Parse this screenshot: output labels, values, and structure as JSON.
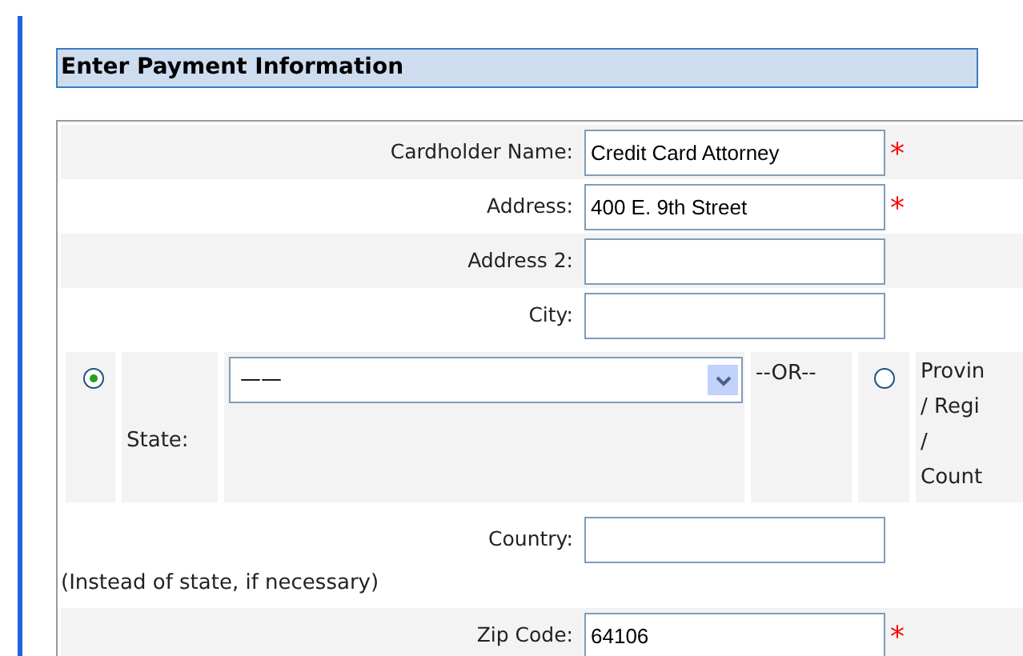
{
  "heading": "Enter Payment Information",
  "fields_top": [
    {
      "label": "Cardholder Name:",
      "value": "Credit Card Attorney",
      "required_mark": "*"
    },
    {
      "label": "Address:",
      "value": "400 E. 9th Street",
      "required_mark": "*"
    },
    {
      "label": "Address 2:"
    },
    {
      "label": "City:"
    }
  ],
  "state_row": {
    "state_radio": {
      "selected": true
    },
    "state_label": "State:",
    "state_select": {
      "value": "——"
    },
    "or_text": "--OR--",
    "province_radio": {
      "selected": false
    },
    "province_label_lines": [
      "Provin",
      "/ Regi",
      "/",
      "Count"
    ]
  },
  "country": {
    "label": "Country:"
  },
  "country_note": "(Instead of state, if necessary)",
  "zip": {
    "label": "Zip Code:",
    "value": "64106",
    "required_mark": "*"
  }
}
